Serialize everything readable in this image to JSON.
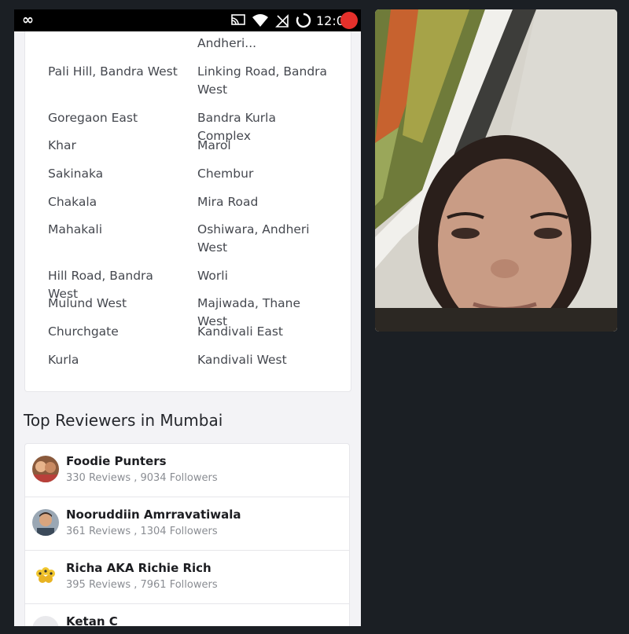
{
  "status_bar": {
    "time": "12:0"
  },
  "localities": {
    "left": [
      "Pali Hill, Bandra West",
      "Goregaon East",
      "Khar",
      "Sakinaka",
      "Chakala",
      "Mahakali",
      "Hill Road, Bandra West",
      "Mulund West",
      "Churchgate",
      "Kurla"
    ],
    "right": [
      "Andheri...",
      "Linking Road, Bandra West",
      "Bandra Kurla Complex",
      "Marol",
      "Chembur",
      "Mira Road",
      "Oshiwara, Andheri West",
      "Worli",
      "Majiwada, Thane West",
      "Kandivali East",
      "Kandivali West"
    ]
  },
  "reviewers_section": {
    "title": "Top Reviewers in Mumbai",
    "items": [
      {
        "name": "Foodie Punters",
        "stats": "330 Reviews , 9034 Followers"
      },
      {
        "name": "Nooruddiin Amrravatiwala",
        "stats": "361 Reviews , 1304 Followers"
      },
      {
        "name": "Richa AKA Richie Rich",
        "stats": "395 Reviews , 7961 Followers"
      },
      {
        "name": "Ketan C",
        "stats": ""
      }
    ]
  },
  "colors": {
    "background": "#1b1f24",
    "recording": "#e5302b"
  }
}
